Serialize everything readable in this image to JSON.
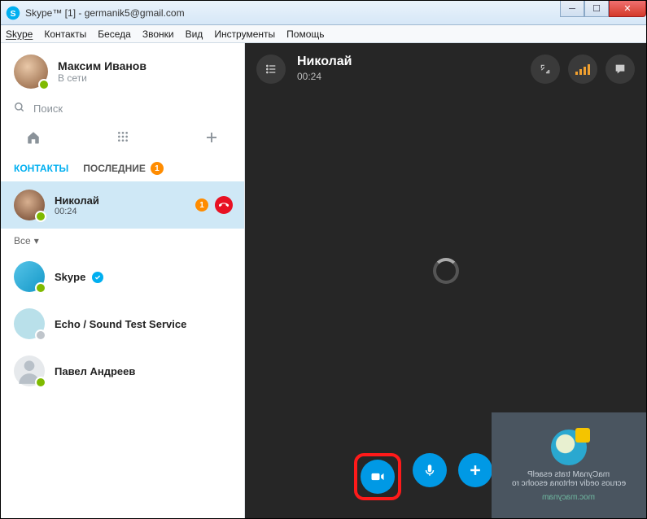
{
  "window": {
    "title": "Skype™ [1] - germanik5@gmail.com"
  },
  "menu": {
    "items": [
      "Skype",
      "Контакты",
      "Беседа",
      "Звонки",
      "Вид",
      "Инструменты",
      "Помощь"
    ]
  },
  "profile": {
    "name": "Максим Иванов",
    "status": "В сети"
  },
  "search": {
    "placeholder": "Поиск"
  },
  "tabs": {
    "contacts": "КОНТАКТЫ",
    "recent": "ПОСЛЕДНИЕ",
    "recent_badge": "1"
  },
  "filter": {
    "label": "Все"
  },
  "contacts": [
    {
      "name": "Николай",
      "sub": "00:24",
      "badge": "1",
      "in_call": true
    },
    {
      "name": "Skype",
      "verified": true
    },
    {
      "name": "Echo / Sound Test Service"
    },
    {
      "name": "Павел Андреев"
    }
  ],
  "call": {
    "title": "Николай",
    "timer": "00:24"
  },
  "preview": {
    "line1": "Please start ManyCam",
    "line2": "or choose another video source",
    "footer": "manycam.com"
  }
}
